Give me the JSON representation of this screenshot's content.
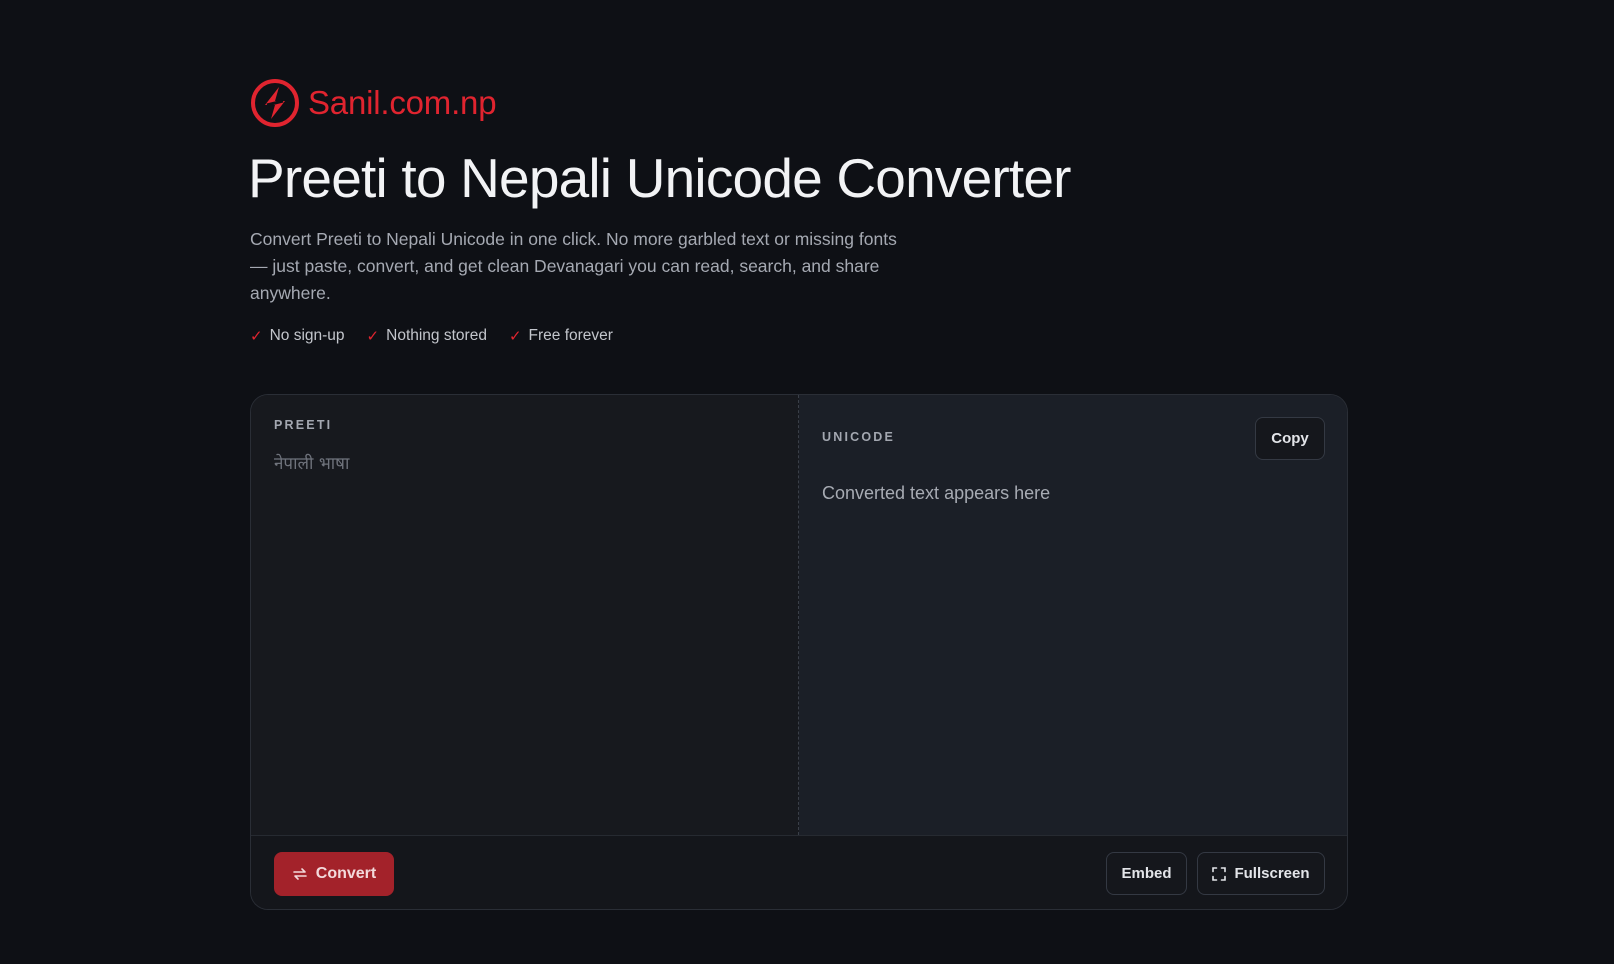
{
  "brand": {
    "name": "Sanil.com.np"
  },
  "page": {
    "title": "Preeti to Nepali Unicode Converter",
    "description": "Convert Preeti to Nepali Unicode in one click. No more garbled text or missing fonts — just paste, convert, and get clean Devanagari you can read, search, and share anywhere."
  },
  "features": [
    {
      "label": "No sign-up"
    },
    {
      "label": "Nothing stored"
    },
    {
      "label": "Free forever"
    }
  ],
  "converter": {
    "input": {
      "label": "PREETI",
      "placeholder": "नेपाली भाषा",
      "value": ""
    },
    "output": {
      "label": "UNICODE",
      "placeholder": "Converted text appears here"
    },
    "copy_label": "Copy",
    "convert_label": "Convert",
    "embed_label": "Embed",
    "fullscreen_label": "Fullscreen"
  },
  "colors": {
    "accent": "#e0242f",
    "convert_button": "#a3222a",
    "background": "#0e1015"
  }
}
